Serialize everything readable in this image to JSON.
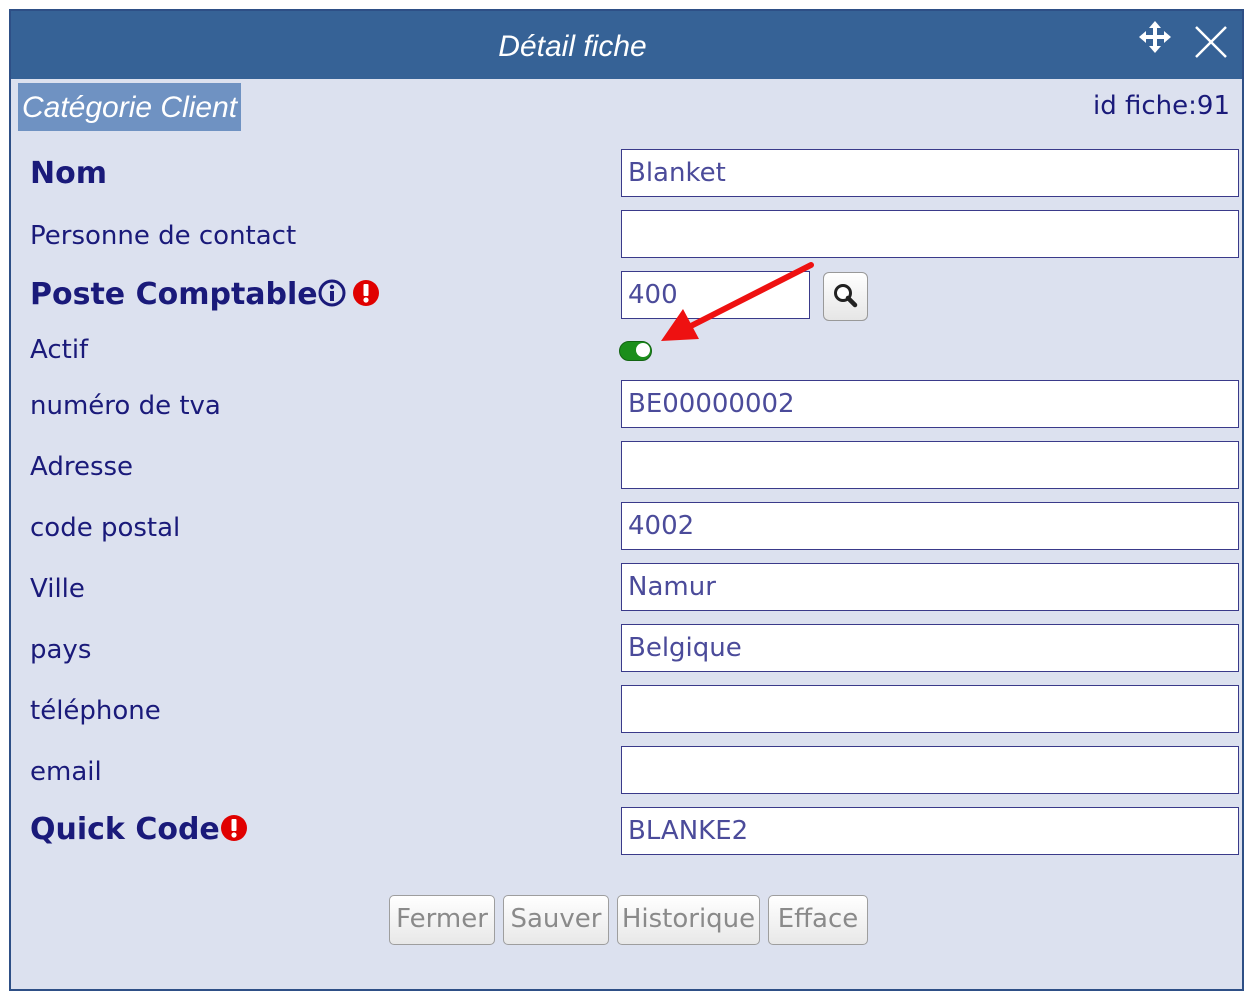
{
  "dialog": {
    "title": "Détail fiche",
    "category": "Catégorie Client",
    "id_label": "id fiche:91"
  },
  "fields": {
    "nom": {
      "label": "Nom",
      "value": "Blanket"
    },
    "contact": {
      "label": "Personne de contact",
      "value": ""
    },
    "poste": {
      "label": "Poste Comptable",
      "value": "400"
    },
    "actif": {
      "label": "Actif",
      "state": "on"
    },
    "tva": {
      "label": "numéro de tva",
      "value": "BE00000002"
    },
    "adresse": {
      "label": "Adresse",
      "value": ""
    },
    "cp": {
      "label": "code postal",
      "value": "4002"
    },
    "ville": {
      "label": "Ville",
      "value": "Namur"
    },
    "pays": {
      "label": "pays",
      "value": "Belgique"
    },
    "tel": {
      "label": "téléphone",
      "value": ""
    },
    "email": {
      "label": "email",
      "value": ""
    },
    "qcode": {
      "label": "Quick Code",
      "value": "BLANKE2"
    }
  },
  "buttons": {
    "fermer": "Fermer",
    "sauver": "Sauver",
    "historique": "Historique",
    "efface": "Efface"
  },
  "icons": [
    "move-icon",
    "close-icon",
    "info-icon",
    "warning-icon",
    "search-icon",
    "red-arrow-annotation"
  ],
  "colors": {
    "titlebar": "#366296",
    "background": "#dce1ef",
    "label": "#1a1a7a",
    "warning": "#e00000",
    "toggle_on": "#1b8e1b",
    "annotation": "#ee1111"
  }
}
